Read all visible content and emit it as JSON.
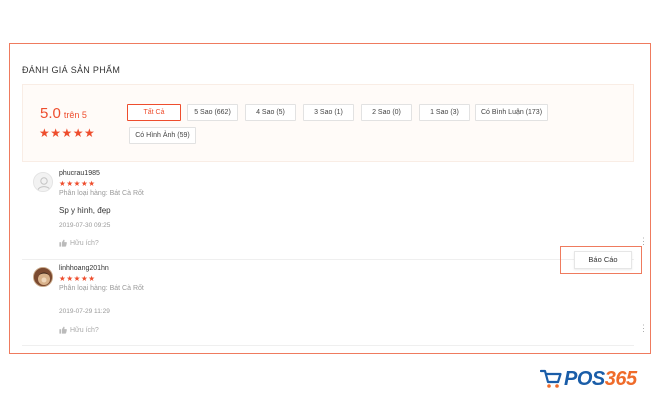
{
  "section_title": "ĐÁNH GIÁ SẢN PHẨM",
  "rating": {
    "score": "5.0",
    "suffix": "trên 5",
    "stars": "★★★★★"
  },
  "filters": [
    {
      "label": "Tất Cả",
      "active": true
    },
    {
      "label": "5 Sao (662)"
    },
    {
      "label": "4 Sao (5)"
    },
    {
      "label": "3 Sao (1)"
    },
    {
      "label": "2 Sao (0)"
    },
    {
      "label": "1 Sao (3)"
    },
    {
      "label": "Có Bình Luận (173)"
    },
    {
      "label": "Có Hình Ảnh (59)"
    }
  ],
  "reviews": [
    {
      "username": "phucrau1985",
      "stars": "★★★★★",
      "variation": "Phân loại hàng: Bát Cà Rốt",
      "comment": "Sp y hình, đẹp",
      "timestamp": "2019-07-30 09:25",
      "helpful": "Hữu ích?",
      "avatar": "default-avatar"
    },
    {
      "username": "linhhoang201hn",
      "stars": "★★★★★",
      "variation": "Phân loại hàng: Bát Cà Rốt",
      "comment": "",
      "timestamp": "2019-07-29 11:29",
      "helpful": "Hữu ích?",
      "avatar": "photo-avatar"
    }
  ],
  "report_button_label": "Báo Cáo",
  "brand": {
    "prefix": "POS",
    "number": "365"
  },
  "colors": {
    "accent": "#ee4d2d",
    "highlight_border": "#ef7b5e",
    "brand_blue": "#1a5da8",
    "brand_orange": "#ef6b2a"
  }
}
